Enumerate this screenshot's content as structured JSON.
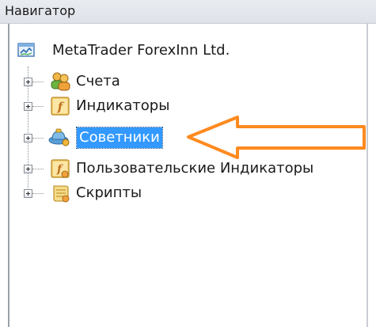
{
  "window": {
    "title": "Навигатор"
  },
  "tree": {
    "root_label": "MetaTrader ForexInn Ltd.",
    "items": [
      {
        "label": "Счета",
        "icon": "accounts-icon"
      },
      {
        "label": "Индикаторы",
        "icon": "indicators-icon"
      },
      {
        "label": "Советники",
        "icon": "expert-advisors-icon",
        "selected": true
      },
      {
        "label": "Пользовательские Индикаторы",
        "icon": "custom-indicators-icon"
      },
      {
        "label": "Скрипты",
        "icon": "scripts-icon"
      }
    ]
  },
  "colors": {
    "selection": "#3399ff",
    "arrow": "#ff8a1f",
    "titlebar": "#dfe3e9"
  }
}
